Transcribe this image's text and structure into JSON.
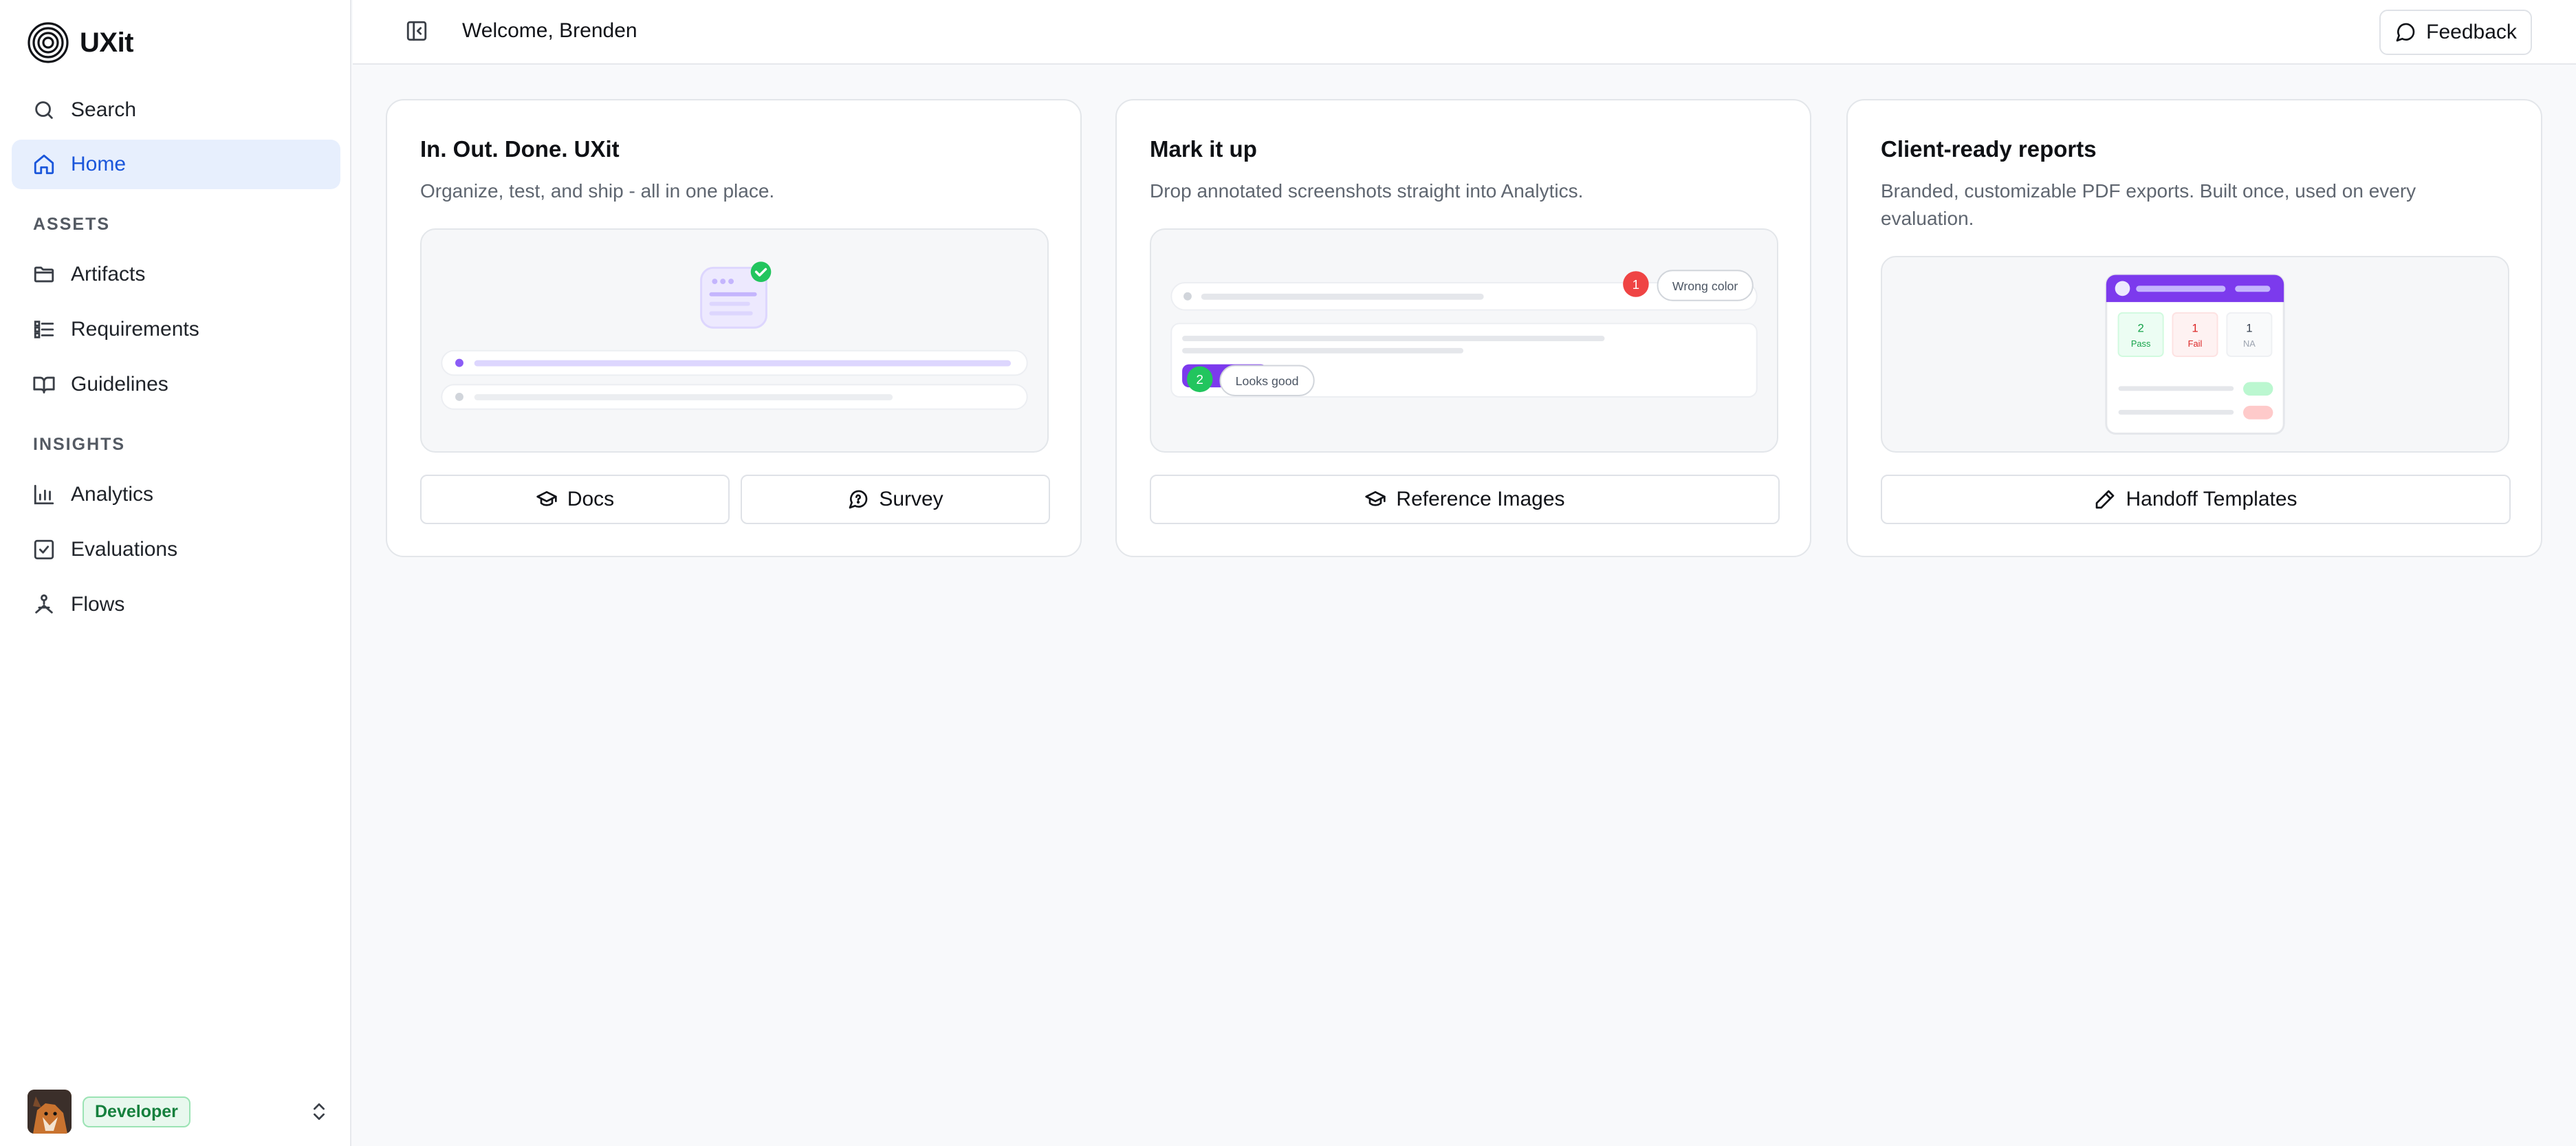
{
  "brand": {
    "name": "UXit"
  },
  "sidebar": {
    "items_top": [
      {
        "label": "Search",
        "icon": "search-icon"
      },
      {
        "label": "Home",
        "icon": "home-icon",
        "active": true
      }
    ],
    "sections": [
      {
        "title": "ASSETS",
        "items": [
          {
            "label": "Artifacts",
            "icon": "folder-icon"
          },
          {
            "label": "Requirements",
            "icon": "list-icon"
          },
          {
            "label": "Guidelines",
            "icon": "book-icon"
          }
        ]
      },
      {
        "title": "INSIGHTS",
        "items": [
          {
            "label": "Analytics",
            "icon": "bar-chart-icon"
          },
          {
            "label": "Evaluations",
            "icon": "checkbox-icon"
          },
          {
            "label": "Flows",
            "icon": "flow-icon"
          }
        ]
      }
    ],
    "user": {
      "role": "Developer"
    }
  },
  "header": {
    "welcome": "Welcome, Brenden",
    "feedback_label": "Feedback"
  },
  "cards": [
    {
      "title": "In. Out. Done. UXit",
      "description": "Organize, test, and ship - all in one place.",
      "buttons": [
        {
          "label": "Docs",
          "icon": "graduation-cap-icon"
        },
        {
          "label": "Survey",
          "icon": "message-circle-icon"
        }
      ]
    },
    {
      "title": "Mark it up",
      "description": "Drop annotated screenshots straight into Analytics.",
      "annotations": [
        {
          "number": "1",
          "text": "Wrong color",
          "color": "#ef4444"
        },
        {
          "number": "2",
          "text": "Looks good",
          "color": "#22c55e"
        }
      ],
      "buttons": [
        {
          "label": "Reference Images",
          "icon": "graduation-cap-icon"
        }
      ]
    },
    {
      "title": "Client-ready reports",
      "description": "Branded, customizable PDF exports. Built once, used on every evaluation.",
      "report_stats": [
        {
          "value": "2",
          "label": "Pass",
          "color": "#16a34a"
        },
        {
          "value": "1",
          "label": "Fail",
          "color": "#dc2626"
        },
        {
          "value": "1",
          "label": "NA",
          "color": "#6b7280"
        }
      ],
      "buttons": [
        {
          "label": "Handoff Templates",
          "icon": "pen-icon"
        }
      ]
    }
  ],
  "colors": {
    "accent": "#1a56db",
    "active_bg": "#e7effd",
    "purple": "#8b5cf6",
    "success": "#22c55e",
    "danger": "#ef4444"
  }
}
